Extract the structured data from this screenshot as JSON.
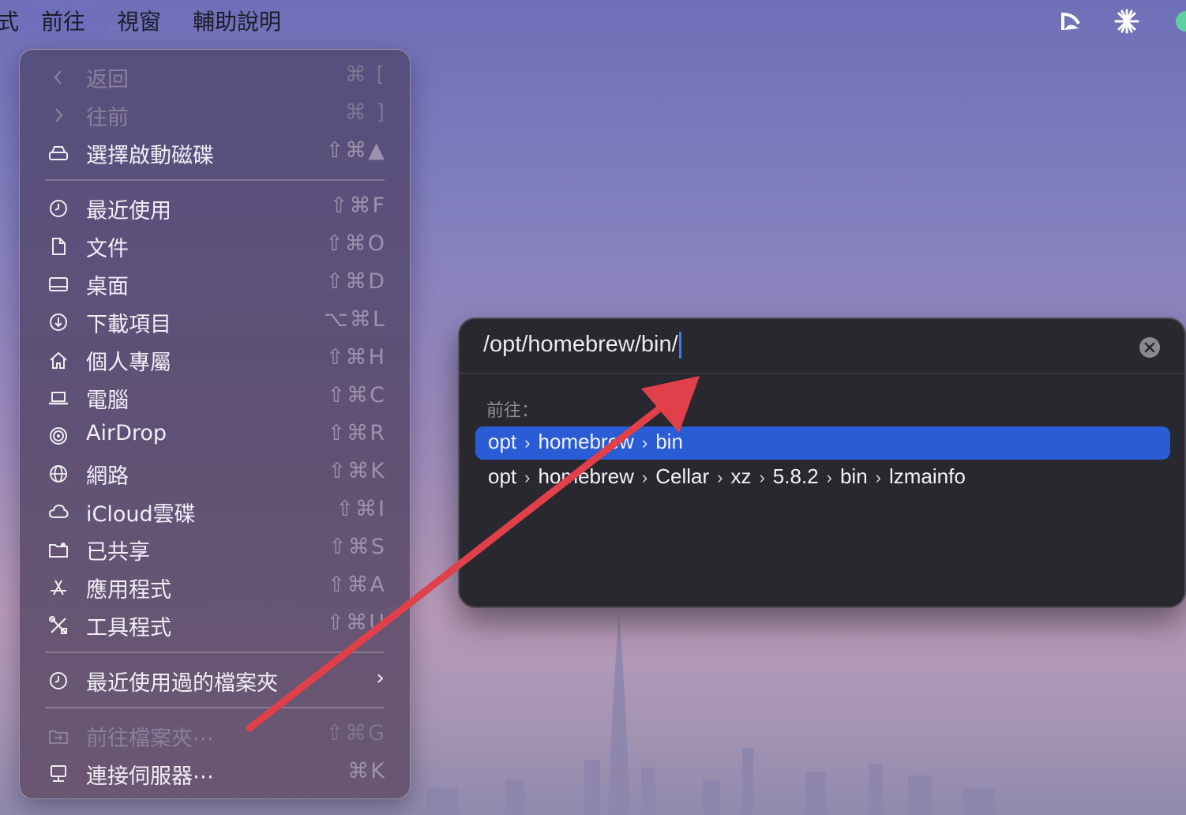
{
  "menubar": {
    "cut_left": "式",
    "items": [
      "前往",
      "視窗",
      "輔助說明"
    ],
    "icons": [
      "cast-icon",
      "sparkle-icon",
      "status-icon"
    ]
  },
  "go_menu": {
    "items": [
      {
        "label": "返回",
        "shortcut": "⌘ [",
        "icon": "chevron-left-icon",
        "disabled": true
      },
      {
        "label": "往前",
        "shortcut": "⌘ ]",
        "icon": "chevron-right-icon",
        "disabled": true
      },
      {
        "label": "選擇啟動磁碟",
        "shortcut": "⇧⌘▲",
        "icon": "disk-icon"
      },
      {
        "label": "最近使用",
        "shortcut": "⇧⌘F",
        "icon": "clock-icon"
      },
      {
        "label": "文件",
        "shortcut": "⇧⌘O",
        "icon": "document-icon"
      },
      {
        "label": "桌面",
        "shortcut": "⇧⌘D",
        "icon": "desktop-icon"
      },
      {
        "label": "下載項目",
        "shortcut": "⌥⌘L",
        "icon": "download-icon"
      },
      {
        "label": "個人專屬",
        "shortcut": "⇧⌘H",
        "icon": "home-icon"
      },
      {
        "label": "電腦",
        "shortcut": "⇧⌘C",
        "icon": "laptop-icon"
      },
      {
        "label": "AirDrop",
        "shortcut": "⇧⌘R",
        "icon": "airdrop-icon"
      },
      {
        "label": "網路",
        "shortcut": "⇧⌘K",
        "icon": "globe-icon"
      },
      {
        "label": "iCloud雲碟",
        "shortcut": "⇧⌘I",
        "icon": "cloud-icon"
      },
      {
        "label": "已共享",
        "shortcut": "⇧⌘S",
        "icon": "shared-folder-icon"
      },
      {
        "label": "應用程式",
        "shortcut": "⇧⌘A",
        "icon": "apps-icon"
      },
      {
        "label": "工具程式",
        "shortcut": "⇧⌘U",
        "icon": "tools-icon"
      },
      {
        "label": "最近使用過的檔案夾",
        "shortcut": "›",
        "icon": "clock-icon"
      },
      {
        "label": "前往檔案夾⋯",
        "shortcut": "⇧⌘G",
        "icon": "go-folder-icon",
        "disabled": true
      },
      {
        "label": "連接伺服器⋯",
        "shortcut": "⌘K",
        "icon": "server-icon"
      }
    ]
  },
  "goto_dialog": {
    "path": "/opt/homebrew/bin/",
    "section_label": "前往：",
    "suggestions": [
      {
        "parts": [
          "opt",
          "homebrew",
          "bin"
        ],
        "selected": true
      },
      {
        "parts": [
          "opt",
          "homebrew",
          "Cellar",
          "xz",
          "5.8.2",
          "bin",
          "lzmainfo"
        ],
        "selected": false
      }
    ]
  },
  "colors": {
    "selection": "#2a5cd6",
    "annotation_arrow": "#e0404a",
    "caret": "#3d7bf5"
  }
}
